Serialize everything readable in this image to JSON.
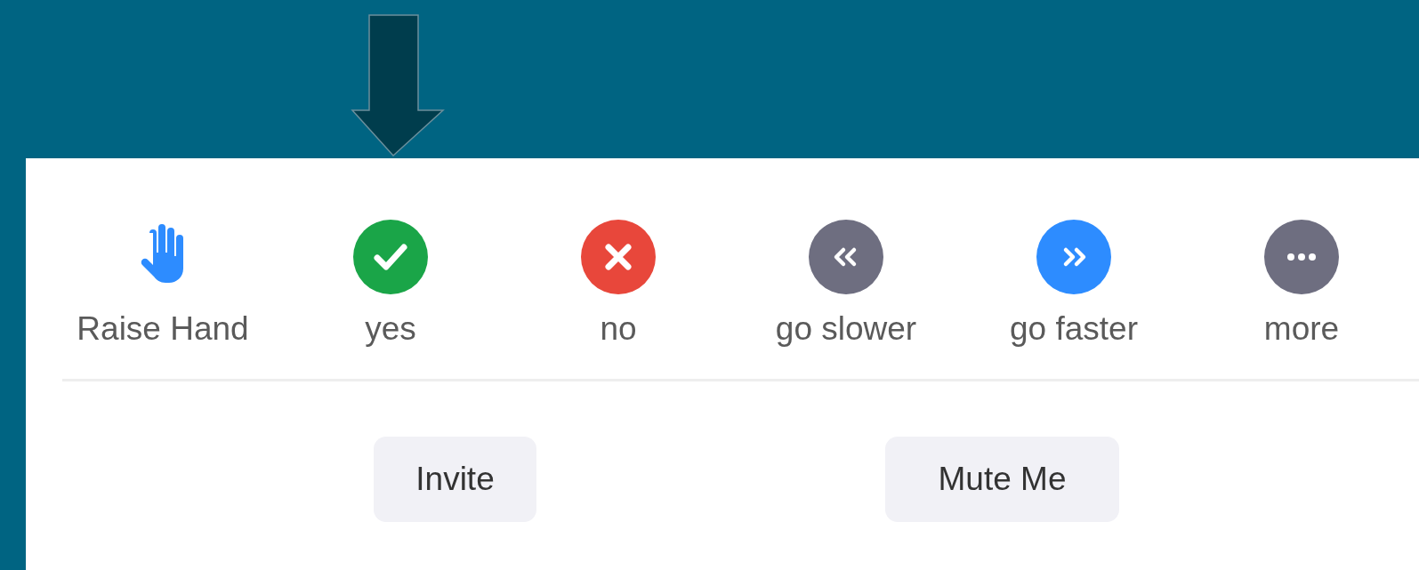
{
  "reactions": [
    {
      "kind": "hand",
      "label": "Raise Hand",
      "color": "#2d8cff"
    },
    {
      "kind": "check",
      "label": "yes",
      "color": "#1aa548"
    },
    {
      "kind": "cross",
      "label": "no",
      "color": "#e8473b"
    },
    {
      "kind": "slower",
      "label": "go slower",
      "color": "#6e6e80"
    },
    {
      "kind": "faster",
      "label": "go faster",
      "color": "#2d8cff"
    },
    {
      "kind": "more",
      "label": "more",
      "color": "#6e6e80"
    }
  ],
  "buttons": [
    "Invite",
    "Mute Me"
  ]
}
